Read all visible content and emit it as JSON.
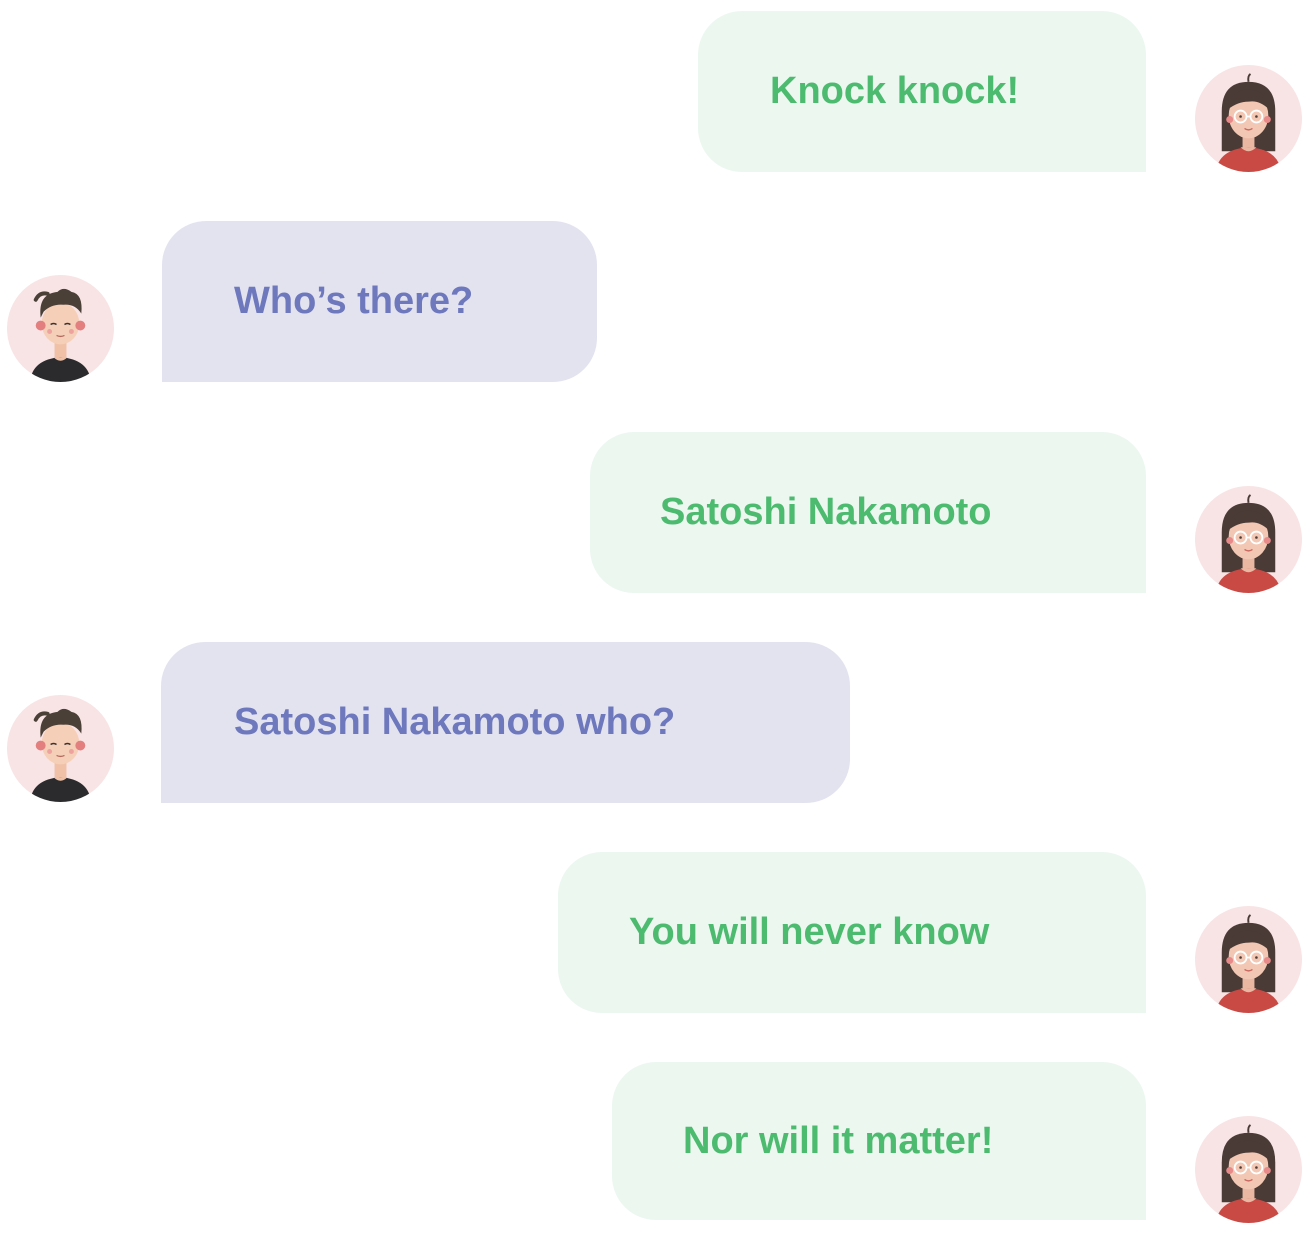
{
  "conversation": {
    "messages": [
      {
        "sender": "her",
        "text": "Knock knock!"
      },
      {
        "sender": "him",
        "text": "Who’s there?"
      },
      {
        "sender": "her",
        "text": "Satoshi Nakamoto"
      },
      {
        "sender": "him",
        "text": "Satoshi Nakamoto who?"
      },
      {
        "sender": "her",
        "text": "You will never know"
      },
      {
        "sender": "her",
        "text": "Nor will it matter!"
      }
    ]
  },
  "colors": {
    "her_bubble": "#ecf7f0",
    "her_text": "#4dbb6f",
    "him_bubble": "#e3e3f0",
    "him_text": "#6e78bd",
    "avatar_background": "#f8e6e6"
  },
  "icons": {
    "her_avatar": "woman-with-glasses-avatar-icon",
    "him_avatar": "man-avatar-icon"
  }
}
